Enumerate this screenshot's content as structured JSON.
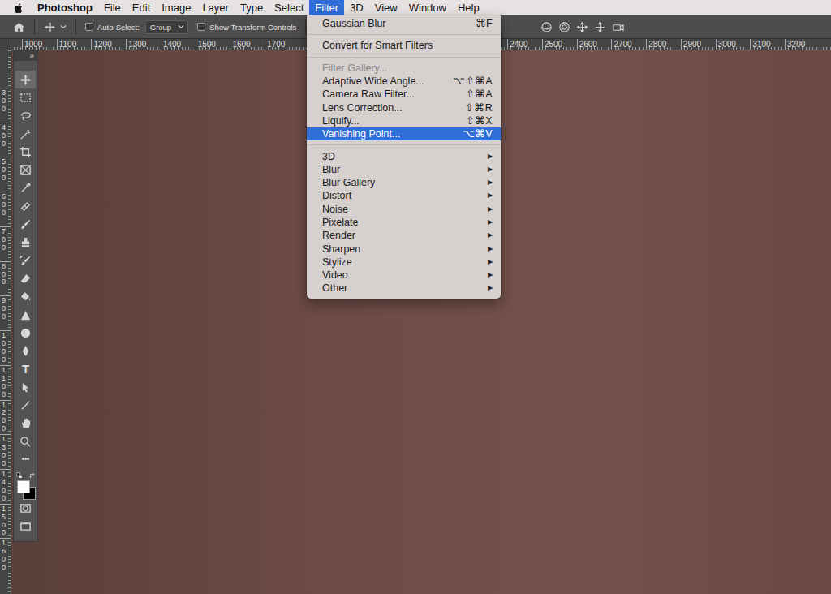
{
  "menubar": {
    "app": "Photoshop",
    "menus": [
      {
        "label": "File",
        "selected": false
      },
      {
        "label": "Edit",
        "selected": false
      },
      {
        "label": "Image",
        "selected": false
      },
      {
        "label": "Layer",
        "selected": false
      },
      {
        "label": "Type",
        "selected": false
      },
      {
        "label": "Select",
        "selected": false
      },
      {
        "label": "Filter",
        "selected": true
      },
      {
        "label": "3D",
        "selected": false
      },
      {
        "label": "View",
        "selected": false
      },
      {
        "label": "Window",
        "selected": false
      },
      {
        "label": "Help",
        "selected": false
      }
    ]
  },
  "options_bar": {
    "auto_select": {
      "label": "Auto-Select:",
      "checked": false
    },
    "target": {
      "value": "Group"
    },
    "transform_controls": {
      "label": "Show Transform Controls",
      "checked": false
    }
  },
  "rulers": {
    "horizontal": [
      "1000",
      "1100",
      "1200",
      "1300",
      "1400",
      "1500",
      "1600",
      "1700",
      "2400",
      "2500",
      "2600",
      "2700",
      "2800",
      "2900",
      "3000",
      "3100",
      "3200"
    ],
    "vertical": [
      "300",
      "400",
      "500",
      "600",
      "700",
      "800",
      "900",
      "1000",
      "1100",
      "1200",
      "1300",
      "1400",
      "1500",
      "1600"
    ]
  },
  "toolbar": {
    "collapse": "»",
    "tools": [
      {
        "name": "move",
        "kind": "icon",
        "selected": true
      },
      {
        "name": "marquee",
        "kind": "icon",
        "selected": false
      },
      {
        "name": "lasso",
        "kind": "icon",
        "selected": false
      },
      {
        "name": "magic-wand",
        "kind": "icon",
        "selected": false
      },
      {
        "name": "crop",
        "kind": "icon",
        "selected": false
      },
      {
        "name": "frame",
        "kind": "icon",
        "selected": false
      },
      {
        "name": "eyedropper",
        "kind": "icon",
        "selected": false
      },
      {
        "name": "healing-brush",
        "kind": "icon",
        "selected": false
      },
      {
        "name": "brush",
        "kind": "icon",
        "selected": false
      },
      {
        "name": "clone-stamp",
        "kind": "icon",
        "selected": false
      },
      {
        "name": "history-brush",
        "kind": "icon",
        "selected": false
      },
      {
        "name": "eraser",
        "kind": "icon",
        "selected": false
      },
      {
        "name": "paint-bucket",
        "kind": "icon",
        "selected": false
      },
      {
        "name": "blur",
        "kind": "icon",
        "selected": false
      },
      {
        "name": "sponge",
        "kind": "icon",
        "selected": false
      },
      {
        "name": "pen",
        "kind": "icon",
        "selected": false
      },
      {
        "name": "type",
        "kind": "glyph",
        "glyph": "T",
        "selected": false
      },
      {
        "name": "path-selection",
        "kind": "icon",
        "selected": false
      },
      {
        "name": "line",
        "kind": "icon",
        "selected": false
      },
      {
        "name": "hand",
        "kind": "icon",
        "selected": false
      },
      {
        "name": "zoom",
        "kind": "icon",
        "selected": false
      },
      {
        "name": "edit-toolbar",
        "kind": "glyph",
        "glyph": "•••",
        "selected": false
      }
    ],
    "colors": {
      "foreground": "#ffffff",
      "background": "#000000"
    },
    "modes": [
      {
        "name": "quick-mask",
        "selected": false
      },
      {
        "name": "screen-mode",
        "selected": false
      }
    ]
  },
  "filter_menu": {
    "groups": [
      [
        {
          "label": "Gaussian Blur",
          "kind": "command",
          "shortcut": "⌘F",
          "disabled": false,
          "selected": false
        }
      ],
      [
        {
          "label": "Convert for Smart Filters",
          "kind": "command",
          "disabled": false,
          "selected": false
        }
      ],
      [
        {
          "label": "Filter Gallery...",
          "kind": "command",
          "disabled": true,
          "selected": false
        },
        {
          "label": "Adaptive Wide Angle...",
          "kind": "command",
          "shortcut": "⌥⇧⌘A",
          "disabled": false,
          "selected": false
        },
        {
          "label": "Camera Raw Filter...",
          "kind": "command",
          "shortcut": "⇧⌘A",
          "disabled": false,
          "selected": false
        },
        {
          "label": "Lens Correction...",
          "kind": "command",
          "shortcut": "⇧⌘R",
          "disabled": false,
          "selected": false
        },
        {
          "label": "Liquify...",
          "kind": "command",
          "shortcut": "⇧⌘X",
          "disabled": false,
          "selected": false
        },
        {
          "label": "Vanishing Point...",
          "kind": "command",
          "shortcut": "⌥⌘V",
          "disabled": false,
          "selected": true
        }
      ],
      [
        {
          "label": "3D",
          "kind": "submenu",
          "arrow": "▶",
          "disabled": false,
          "selected": false
        },
        {
          "label": "Blur",
          "kind": "submenu",
          "arrow": "▶",
          "disabled": false,
          "selected": false
        },
        {
          "label": "Blur Gallery",
          "kind": "submenu",
          "arrow": "▶",
          "disabled": false,
          "selected": false
        },
        {
          "label": "Distort",
          "kind": "submenu",
          "arrow": "▶",
          "disabled": false,
          "selected": false
        },
        {
          "label": "Noise",
          "kind": "submenu",
          "arrow": "▶",
          "disabled": false,
          "selected": false
        },
        {
          "label": "Pixelate",
          "kind": "submenu",
          "arrow": "▶",
          "disabled": false,
          "selected": false
        },
        {
          "label": "Render",
          "kind": "submenu",
          "arrow": "▶",
          "disabled": false,
          "selected": false
        },
        {
          "label": "Sharpen",
          "kind": "submenu",
          "arrow": "▶",
          "disabled": false,
          "selected": false
        },
        {
          "label": "Stylize",
          "kind": "submenu",
          "arrow": "▶",
          "disabled": false,
          "selected": false
        },
        {
          "label": "Video",
          "kind": "submenu",
          "arrow": "▶",
          "disabled": false,
          "selected": false
        },
        {
          "label": "Other",
          "kind": "submenu",
          "arrow": "▶",
          "disabled": false,
          "selected": false
        }
      ]
    ]
  }
}
